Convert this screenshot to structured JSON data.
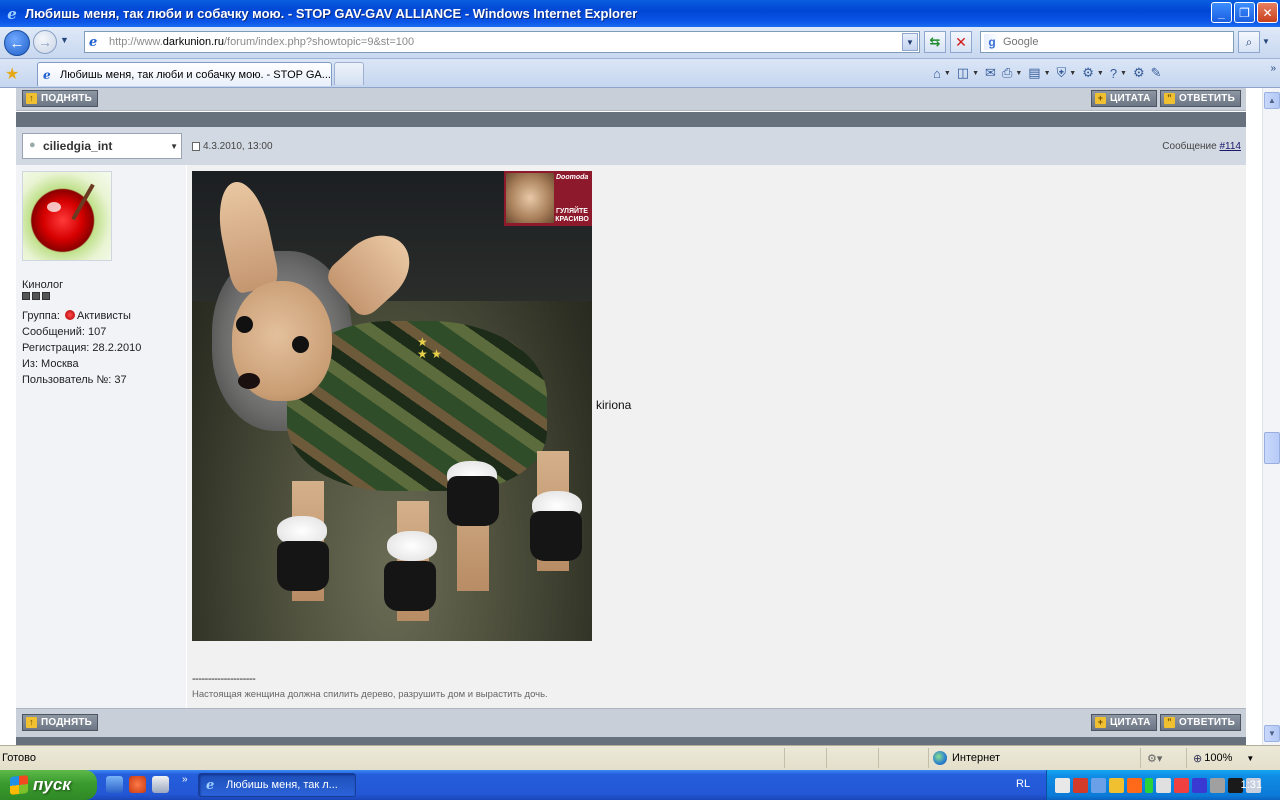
{
  "window": {
    "title": "Любишь меня, так люби и собачку мою. - STOP GAV-GAV ALLIANCE - Windows Internet Explorer",
    "buttons": {
      "minimize": "_",
      "maximize": "❐",
      "close": "✕"
    }
  },
  "nav": {
    "url_prefix": "http://www.",
    "url_domain": "darkunion.ru",
    "url_path": "/forum/index.php?showtopic=9&st=100",
    "search_placeholder": "Google"
  },
  "tabs": [
    {
      "label": "Любишь меня, так люби и собачку мою. - STOP GA..."
    }
  ],
  "forum": {
    "top_up_label": "ПОДНЯТЬ",
    "top_quote_label": "ЦИТАТА",
    "top_reply_label": "ОТВЕТИТЬ",
    "post": {
      "author": "ciliedgia_int",
      "date": "4.3.2010, 13:00",
      "number_prefix": "Сообщение",
      "number_link": "#114",
      "user_rank": "Кинолог",
      "group_label": "Группа:",
      "group_value": "Активисты",
      "messages": "Сообщений: 107",
      "registered": "Регистрация: 28.2.2010",
      "from": "Из: Москва",
      "user_no": "Пользователь №: 37",
      "text": "kiriona",
      "image_ad_brand": "Doomoda",
      "image_ad_text": "ГУЛЯЙТЕ КРАСИВО",
      "signature_separator": "--------------------",
      "signature": "Настоящая женщина должна спилить дерево, разрушить дом и вырастить дочь."
    },
    "bottom_up_label": "ПОДНЯТЬ",
    "bottom_quote_label": "ЦИТАТА",
    "bottom_reply_label": "ОТВЕТИТЬ"
  },
  "status": {
    "text": "Готово",
    "zone": "Интернет",
    "zoom": "100%"
  },
  "taskbar": {
    "start": "пуск",
    "task": "Любишь меня, так л...",
    "lang": "RL",
    "clock": "1:31"
  }
}
